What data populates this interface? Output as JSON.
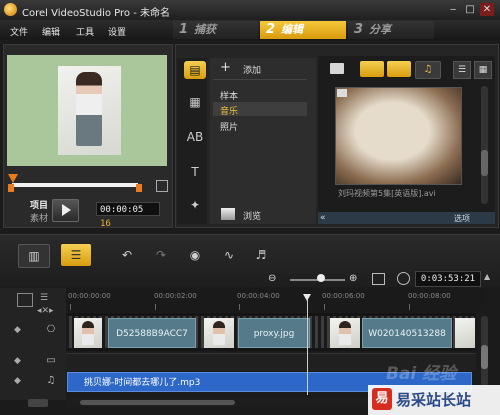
{
  "window": {
    "title": "Corel VideoStudio Pro - 未命名",
    "minimize": "‒",
    "maximize": "□",
    "close": "✕"
  },
  "menu": {
    "file": "文件",
    "edit": "编辑",
    "tools": "工具",
    "settings": "设置"
  },
  "steps": [
    {
      "num": "1",
      "label": "捕获"
    },
    {
      "num": "2",
      "label": "编辑"
    },
    {
      "num": "3",
      "label": "分享"
    }
  ],
  "preview": {
    "project_label": "项目",
    "clip_label": "素材",
    "timecode_main": "00:00:05",
    "timecode_frame": "16"
  },
  "library": {
    "add_label": "添加",
    "categories": [
      "样本",
      "音乐",
      "照片"
    ],
    "selected_category": "音乐",
    "browse_label": "浏览",
    "thumb_caption": "刘玛视频第5集[英语版].avi",
    "options_label": "选项"
  },
  "timeline": {
    "timecode": "0:03:53:21",
    "ruler_labels": [
      "00:00:00:00",
      "00:00:02:00",
      "00:00:04:00",
      "00:00:06:00",
      "00:00:08:00"
    ],
    "clips": [
      "D52588B9ACC7",
      "proxy.jpg",
      "W020140513288"
    ],
    "audio_clip": "挑贝娜-时间都去哪儿了.mp3"
  },
  "watermark": {
    "logo_char": "易",
    "text": "易采站长站",
    "ghost": "Bai 经验"
  }
}
